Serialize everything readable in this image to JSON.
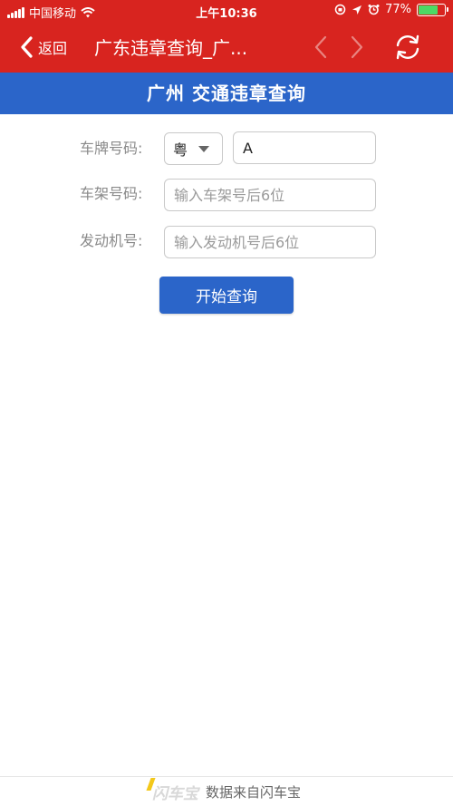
{
  "status_bar": {
    "carrier": "中国移动",
    "time": "上午10:36",
    "battery": "77%",
    "battery_level": 0.77
  },
  "nav": {
    "back_label": "返回",
    "title": "广东违章查询_广..."
  },
  "header": {
    "title": "广州 交通违章查询"
  },
  "form": {
    "plate_label": "车牌号码:",
    "province_value": "粤",
    "plate_value": "A",
    "frame_label": "车架号码:",
    "frame_placeholder": "输入车架号后6位",
    "engine_label": "发动机号:",
    "engine_placeholder": "输入发动机号后6位",
    "submit_label": "开始查询"
  },
  "footer": {
    "logo": "闪车宝",
    "text": "数据来自闪车宝"
  },
  "colors": {
    "brand_red": "#d8241f",
    "header_blue": "#2b65c9",
    "battery_green": "#4cd964"
  }
}
